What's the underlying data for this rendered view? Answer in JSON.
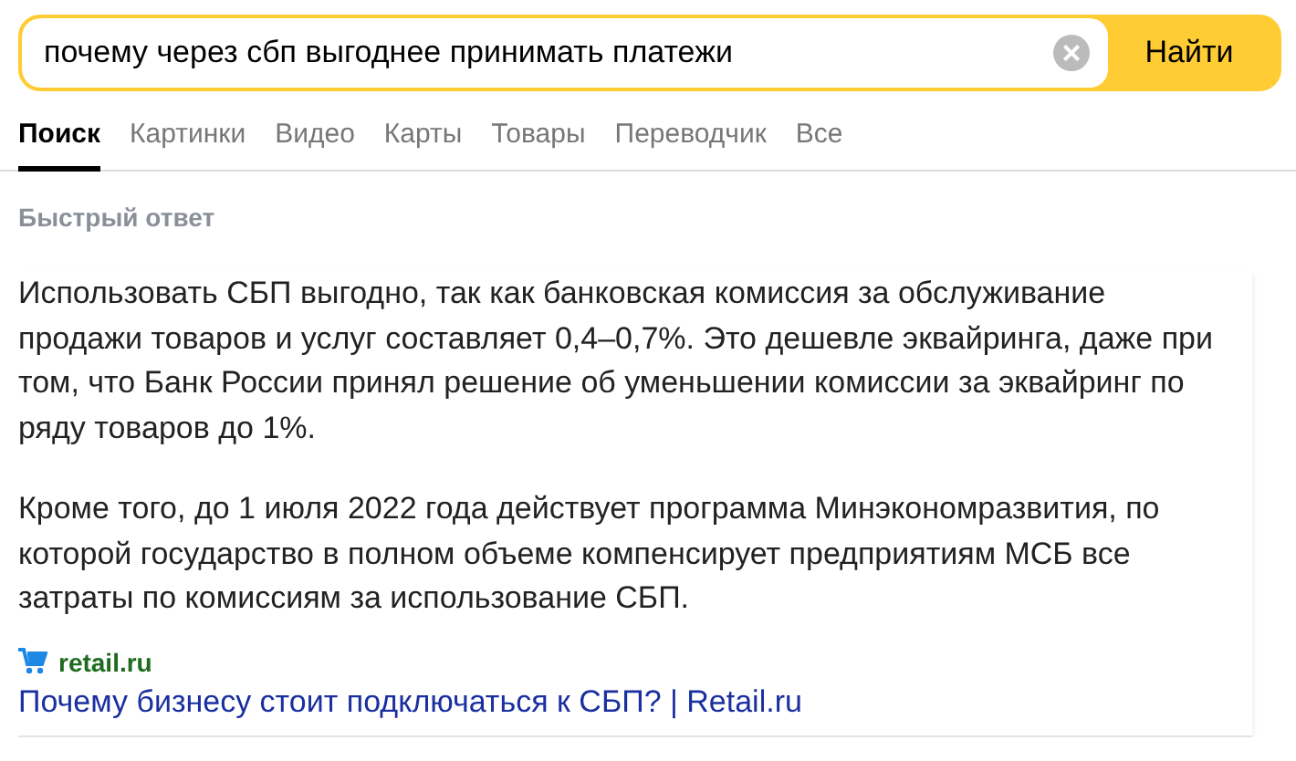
{
  "search": {
    "value": "почему через сбп выгоднее принимать платежи",
    "clear_icon": "×",
    "button": "Найти"
  },
  "tabs": [
    {
      "label": "Поиск",
      "selected": true
    },
    {
      "label": "Картинки",
      "selected": false
    },
    {
      "label": "Видео",
      "selected": false
    },
    {
      "label": "Карты",
      "selected": false
    },
    {
      "label": "Товары",
      "selected": false
    },
    {
      "label": "Переводчик",
      "selected": false
    },
    {
      "label": "Все",
      "selected": false
    }
  ],
  "quick_answer": {
    "heading": "Быстрый ответ",
    "paragraphs": [
      "Использовать СБП выгодно, так как банковская комиссия за обслуживание продажи товаров и услуг составляет 0,4–0,7%. Это дешевле эквайринга, даже при том, что Банк России принял решение об уменьшении комиссии за эквайринг по ряду товаров до 1%.",
      "Кроме того, до 1 июля 2022 года действует программа Минэкономразвития, по которой государство в полном объеме компенсирует предприятиям МСБ все затраты по комиссиям за использование СБП."
    ],
    "source": "retail.ru",
    "link": "Почему бизнесу стоит подключаться к СБП? | Retail.ru"
  }
}
